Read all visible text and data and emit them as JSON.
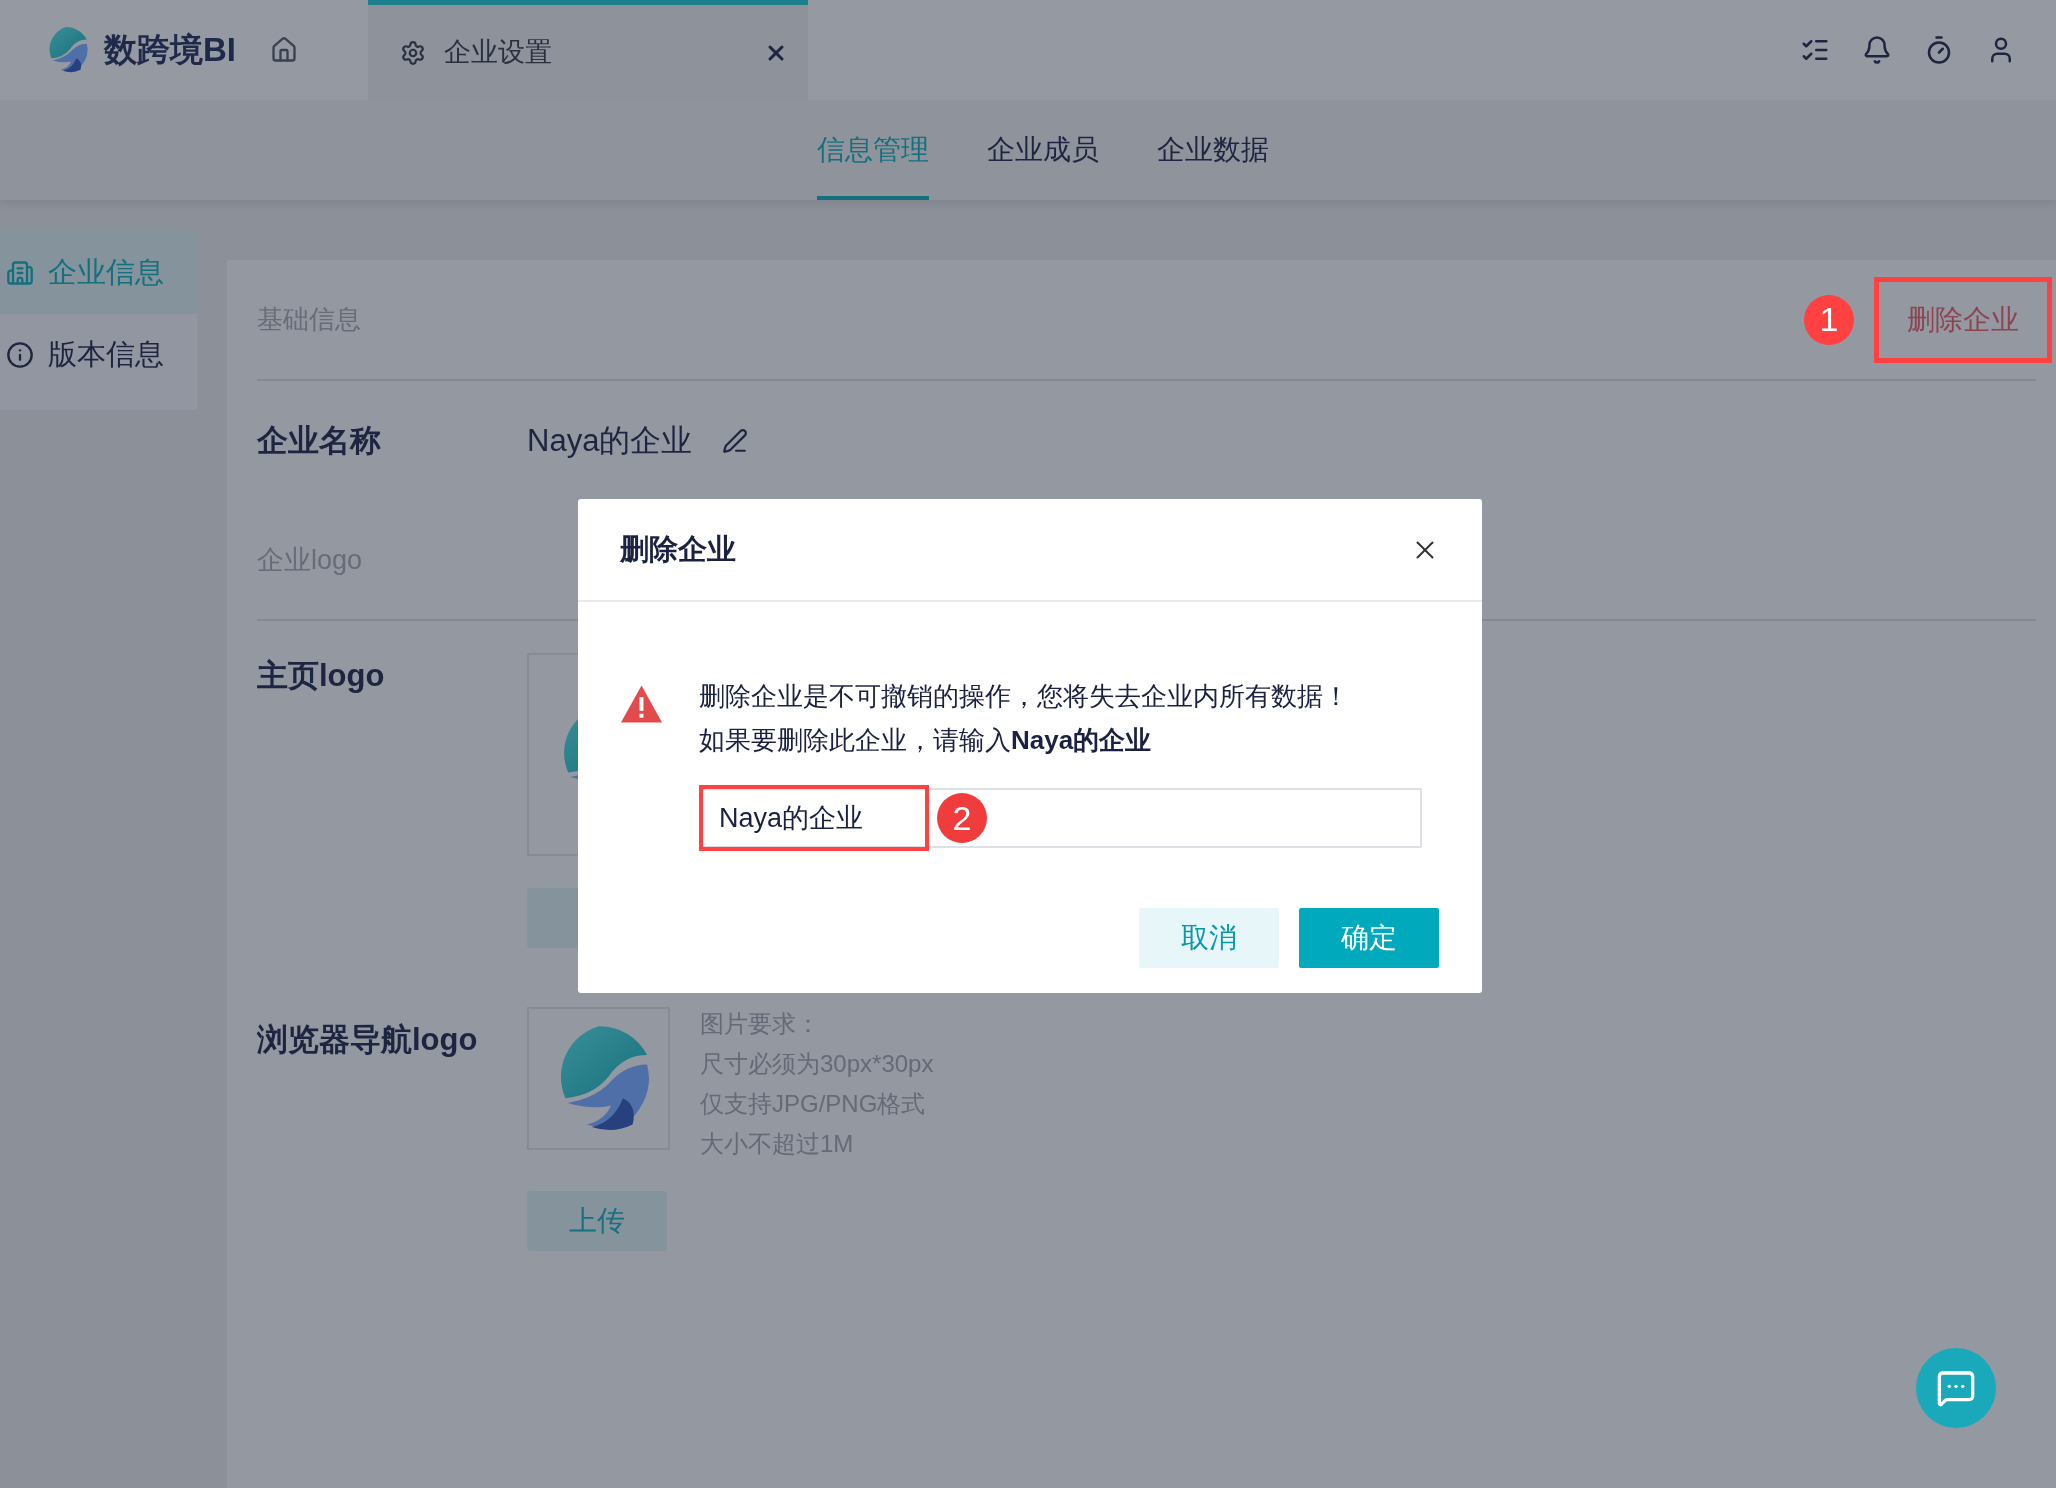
{
  "app": {
    "logo_text": "数跨境BI"
  },
  "tabs": [
    {
      "label": "企业设置",
      "selected": true
    }
  ],
  "sub_nav": [
    {
      "label": "信息管理",
      "selected": true
    },
    {
      "label": "企业成员",
      "selected": false
    },
    {
      "label": "企业数据",
      "selected": false
    }
  ],
  "sidebar": {
    "items": [
      {
        "label": "企业信息",
        "selected": true
      },
      {
        "label": "版本信息",
        "selected": false
      }
    ]
  },
  "section": {
    "title": "基础信息",
    "delete_button": "删除企业",
    "delete_marker": "1"
  },
  "company_name": {
    "label": "企业名称",
    "value": "Naya的企业"
  },
  "logo_section": {
    "title": "企业logo"
  },
  "home_logo": {
    "label": "主页logo"
  },
  "browser_logo": {
    "label": "浏览器导航logo",
    "requirements": [
      "图片要求：",
      "尺寸必须为30px*30px",
      "仅支持JPG/PNG格式",
      "大小不超过1M"
    ],
    "upload_button": "上传"
  },
  "dialog": {
    "title": "删除企业",
    "message_lines": [
      "删除企业是不可撤销的操作，您将失去企业内所有数据！",
      "如果要删除此企业，请输入**Naya的企业**"
    ],
    "input_value": "Naya的企业",
    "input_marker": "2",
    "buttons": [
      {
        "label": "取消",
        "kind": "secondary"
      },
      {
        "label": "确定",
        "kind": "primary"
      }
    ]
  }
}
